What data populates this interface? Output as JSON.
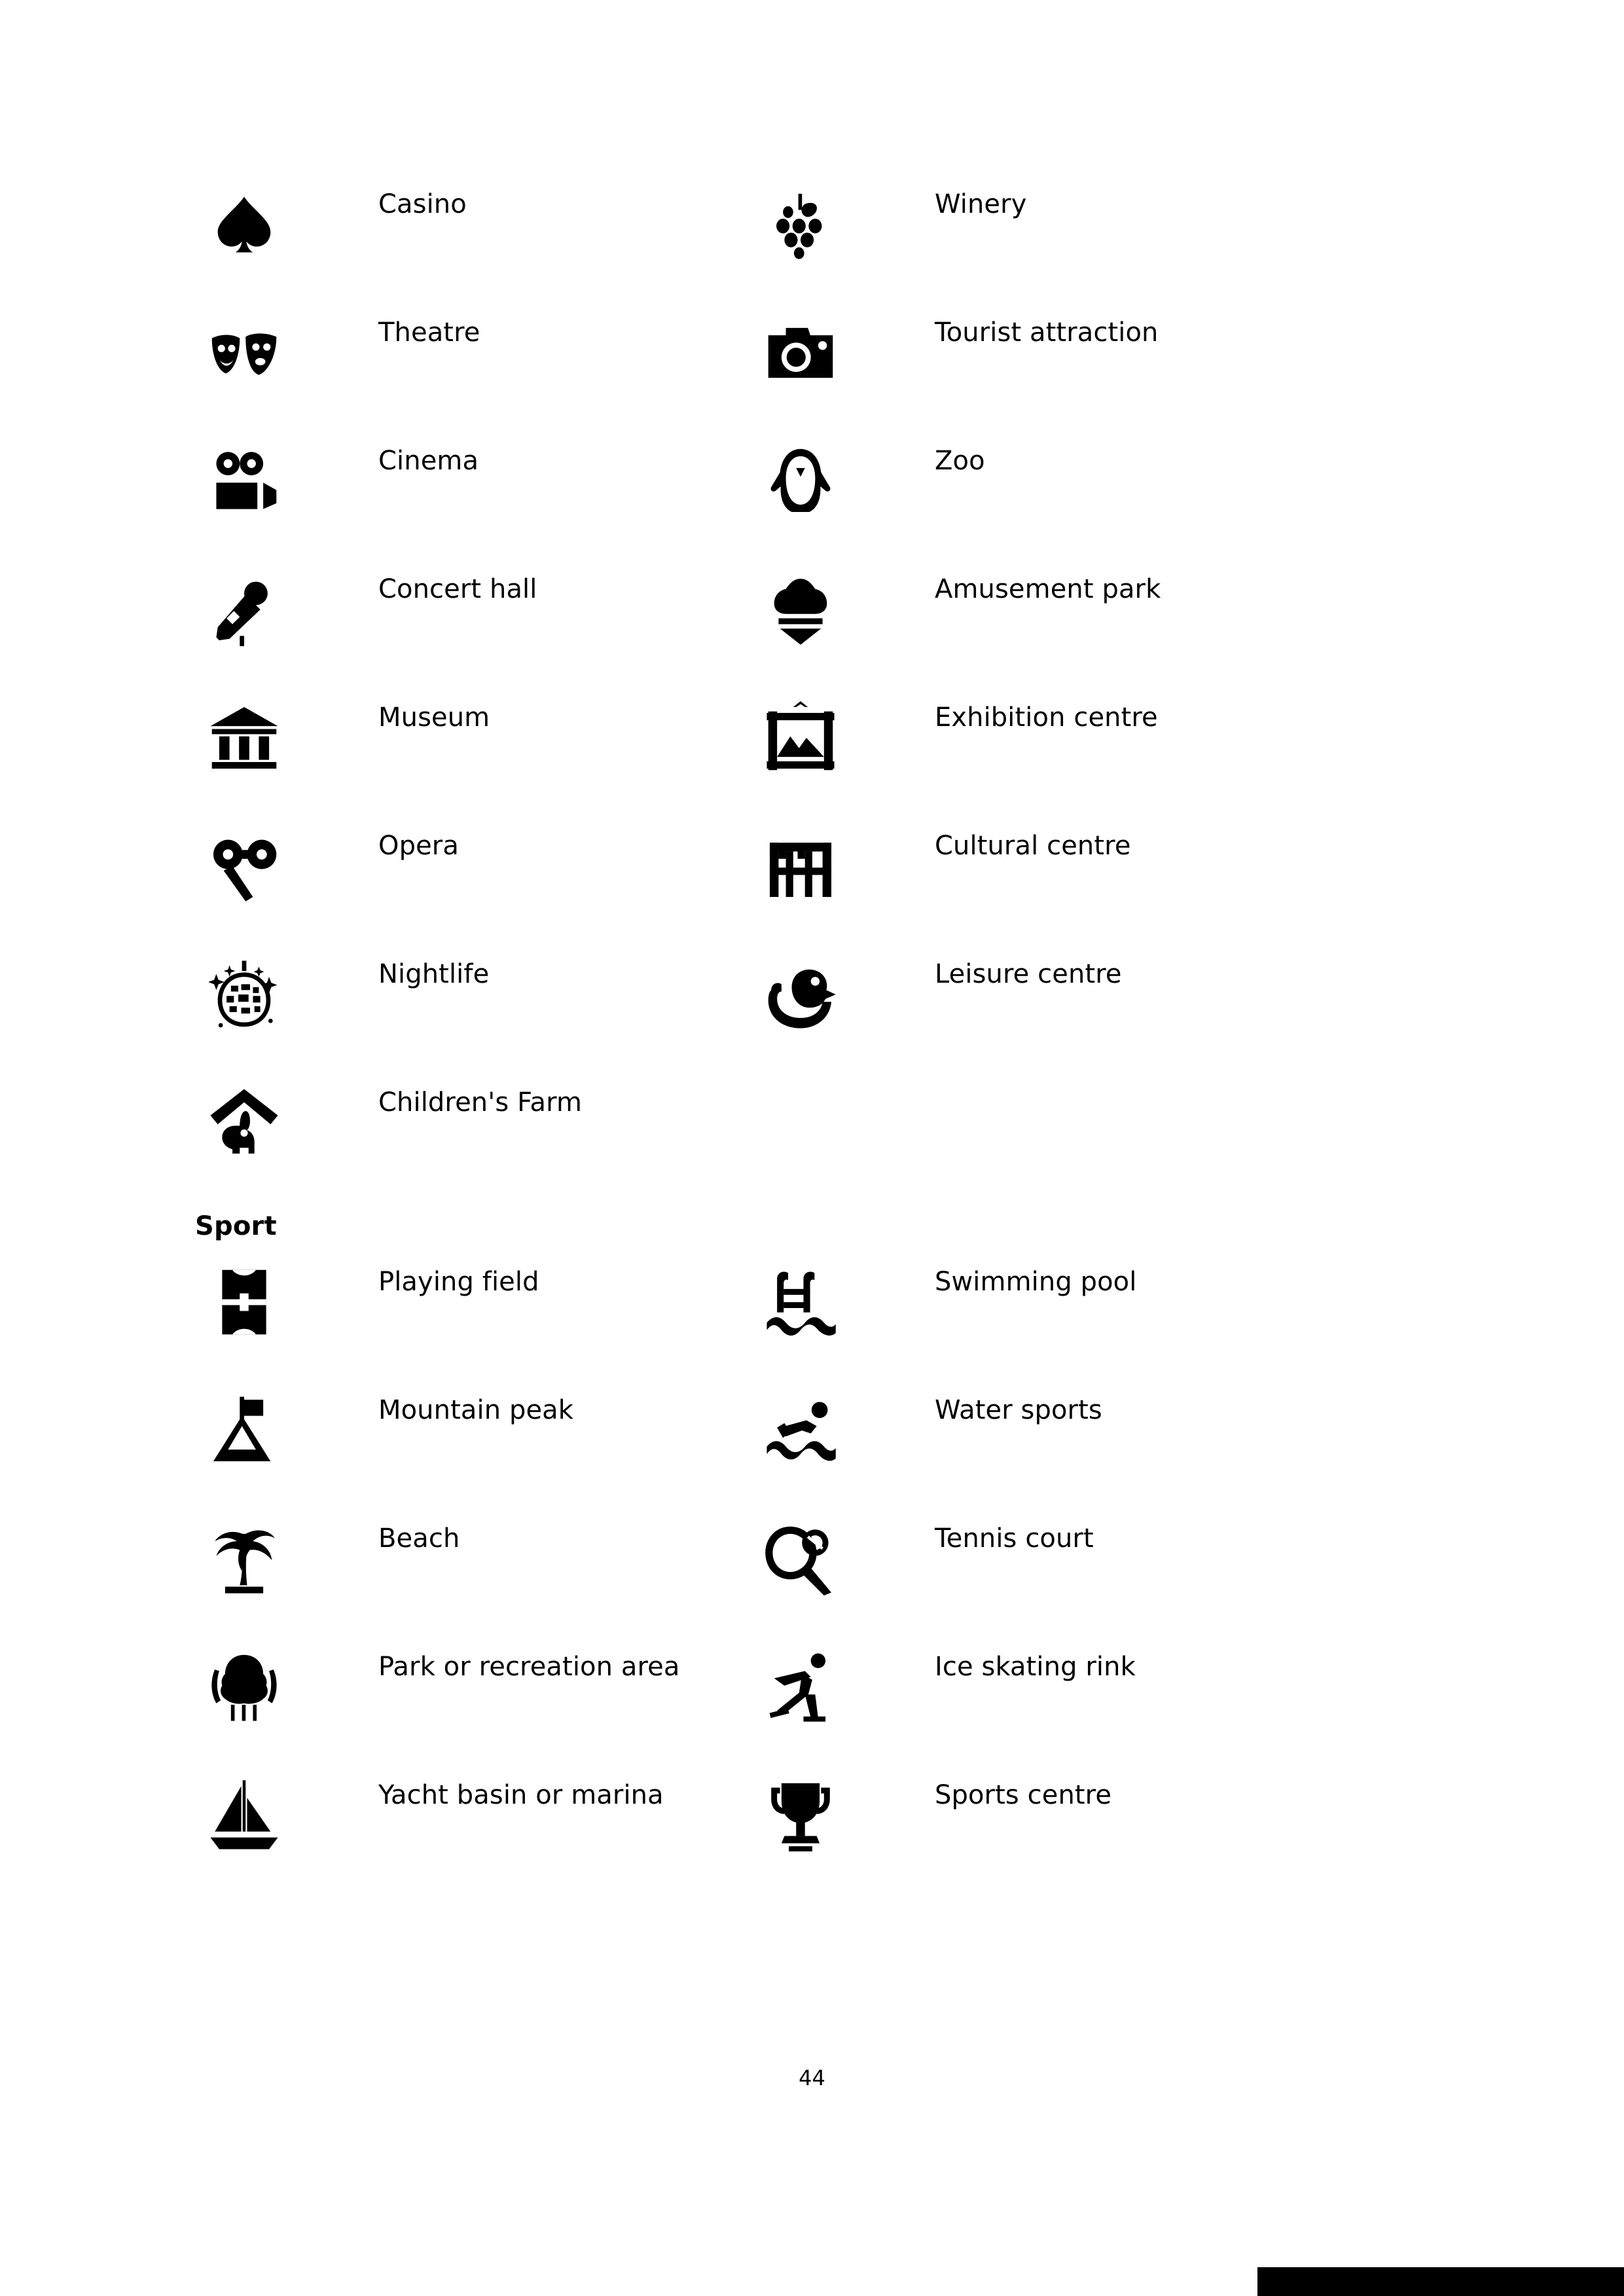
{
  "document": {
    "page_number": "44"
  },
  "sections": [
    {
      "title": "",
      "rows": [
        {
          "left": {
            "icon": "spade-icon",
            "label": "Casino"
          },
          "right": {
            "icon": "grapes-icon",
            "label": "Winery"
          }
        },
        {
          "left": {
            "icon": "theatre-masks-icon",
            "label": "Theatre"
          },
          "right": {
            "icon": "camera-icon",
            "label": "Tourist attraction"
          }
        },
        {
          "left": {
            "icon": "movie-camera-icon",
            "label": "Cinema"
          },
          "right": {
            "icon": "penguin-icon",
            "label": "Zoo"
          }
        },
        {
          "left": {
            "icon": "microphone-icon",
            "label": "Concert hall"
          },
          "right": {
            "icon": "ice-cream-cone-icon",
            "label": "Amusement park"
          }
        },
        {
          "left": {
            "icon": "museum-building-icon",
            "label": "Museum"
          },
          "right": {
            "icon": "framed-picture-icon",
            "label": "Exhibition centre"
          }
        },
        {
          "left": {
            "icon": "opera-glasses-icon",
            "label": "Opera"
          },
          "right": {
            "icon": "arched-building-icon",
            "label": "Cultural centre"
          }
        },
        {
          "left": {
            "icon": "disco-ball-icon",
            "label": "Nightlife"
          },
          "right": {
            "icon": "rubber-duck-icon",
            "label": "Leisure centre"
          }
        },
        {
          "left": {
            "icon": "rabbit-barn-icon",
            "label": "Children's Farm"
          },
          "right": null
        }
      ]
    },
    {
      "title": "Sport",
      "rows": [
        {
          "left": {
            "icon": "playing-field-icon",
            "label": "Playing field"
          },
          "right": {
            "icon": "swimming-pool-icon",
            "label": "Swimming pool"
          }
        },
        {
          "left": {
            "icon": "mountain-peak-icon",
            "label": "Mountain peak"
          },
          "right": {
            "icon": "water-sports-icon",
            "label": "Water sports"
          }
        },
        {
          "left": {
            "icon": "palm-tree-icon",
            "label": "Beach"
          },
          "right": {
            "icon": "tennis-racket-icon",
            "label": "Tennis court"
          }
        },
        {
          "left": {
            "icon": "tree-park-icon",
            "label": "Park or recreation area"
          },
          "right": {
            "icon": "ice-skater-icon",
            "label": "Ice skating rink"
          }
        },
        {
          "left": {
            "icon": "sailboat-icon",
            "label": "Yacht basin or marina"
          },
          "right": {
            "icon": "trophy-icon",
            "label": "Sports centre"
          }
        }
      ]
    }
  ]
}
